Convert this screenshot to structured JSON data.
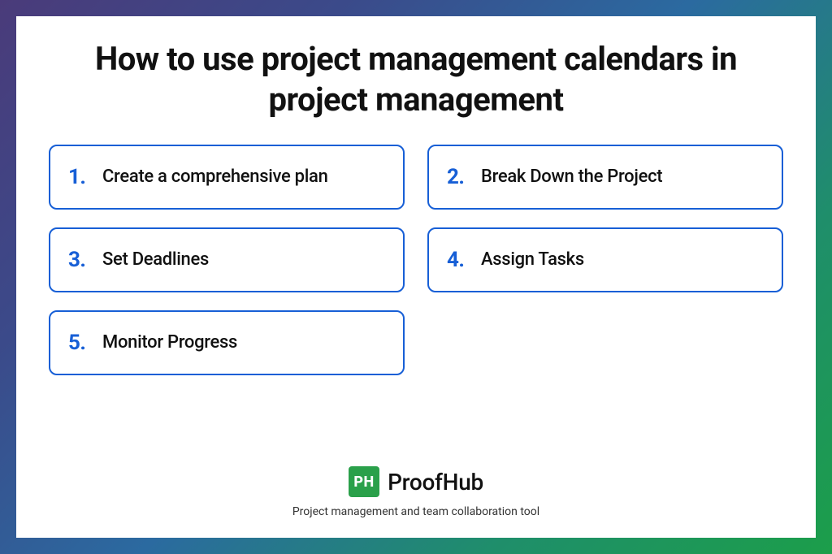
{
  "title": "How to use project  management calendars in project management",
  "steps": [
    {
      "num": "1.",
      "text": "Create a comprehensive plan"
    },
    {
      "num": "2.",
      "text": "Break Down the Project"
    },
    {
      "num": "3.",
      "text": "Set Deadlines"
    },
    {
      "num": "4.",
      "text": "Assign Tasks"
    },
    {
      "num": "5.",
      "text": "Monitor Progress"
    }
  ],
  "brand": {
    "logo_text": "PH",
    "name": "ProofHub",
    "tagline": "Project management and team collaboration tool"
  },
  "colors": {
    "accent": "#175fd6",
    "brand_green": "#2aa04a"
  }
}
